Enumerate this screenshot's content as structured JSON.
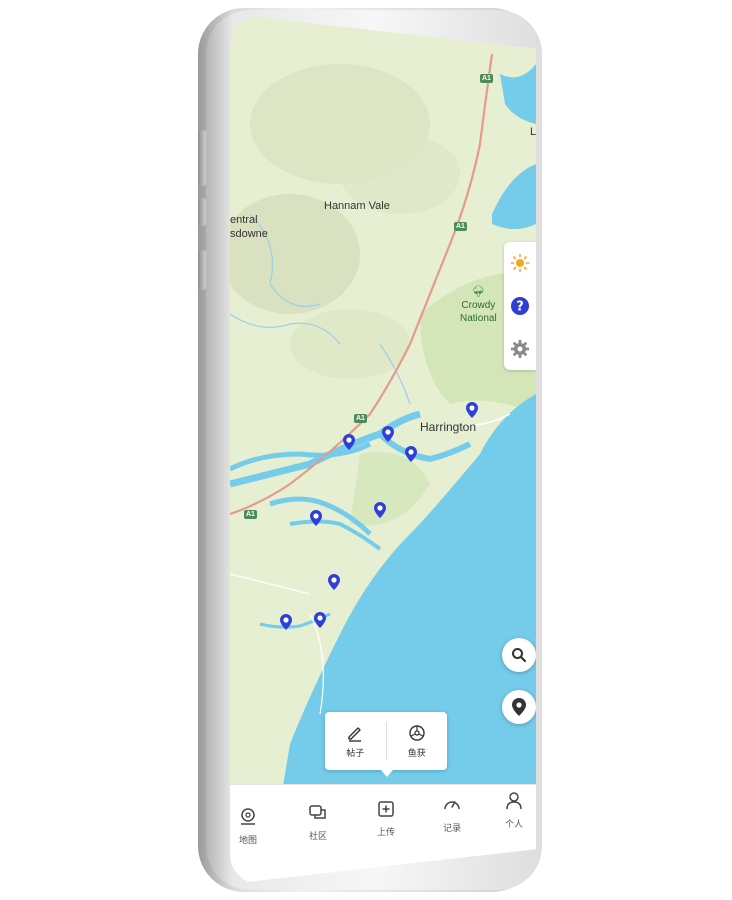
{
  "map": {
    "labels": {
      "hannam_vale": "Hannam Vale",
      "central": "entral",
      "lansdowne": "sdowne",
      "crowdy": "Crowdy",
      "national": "National",
      "harrington": "Harrington",
      "edge_l": "L"
    },
    "road_shields": [
      "A1",
      "A1",
      "A1",
      "A1"
    ],
    "pin_color": "#2f3fd6",
    "water_color": "#74cbea",
    "land_color": "#e7efd2"
  },
  "side_panel": {
    "items": [
      "sun-icon",
      "help-icon",
      "settings-icon"
    ]
  },
  "popup": {
    "post_label": "帖子",
    "catch_label": "鱼获"
  },
  "tabbar": {
    "map": "地图",
    "community": "社区",
    "upload": "上传",
    "records": "记录",
    "profile": "个人"
  }
}
